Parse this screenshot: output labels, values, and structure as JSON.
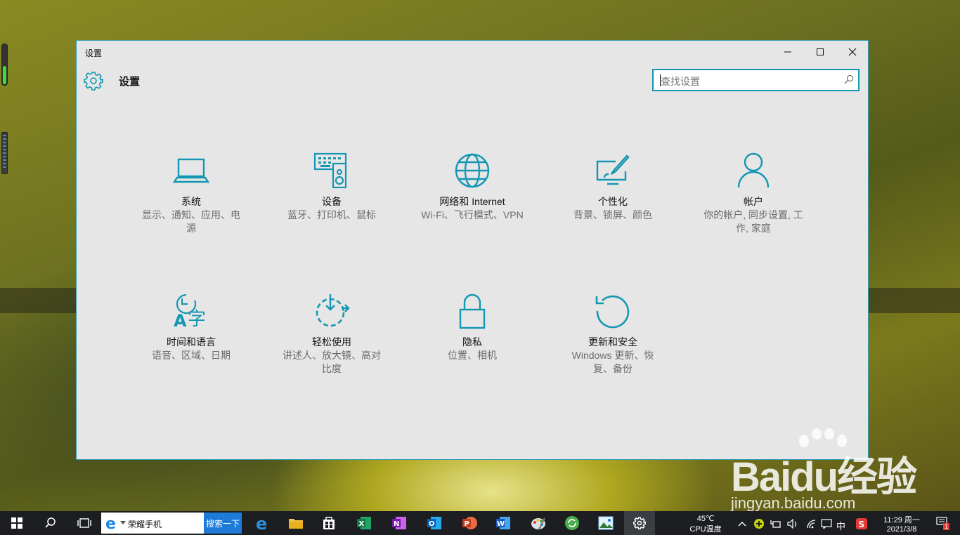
{
  "window": {
    "title": "设置",
    "header_label": "设置",
    "search_placeholder": "查找设置"
  },
  "tiles": [
    {
      "name": "系统",
      "desc1": "显示、通知、应用、电",
      "desc2": "源",
      "icon": "laptop-icon"
    },
    {
      "name": "设备",
      "desc1": "蓝牙、打印机、鼠标",
      "desc2": "",
      "icon": "devices-icon"
    },
    {
      "name": "网络和 Internet",
      "desc1": "Wi-Fi、飞行模式、VPN",
      "desc2": "",
      "icon": "globe-icon"
    },
    {
      "name": "个性化",
      "desc1": "背景、锁屏、颜色",
      "desc2": "",
      "icon": "personalization-icon"
    },
    {
      "name": "帐户",
      "desc1": "你的帐户, 同步设置, 工",
      "desc2": "作, 家庭",
      "icon": "person-icon"
    },
    {
      "name": "时间和语言",
      "desc1": "语音、区域、日期",
      "desc2": "",
      "icon": "time-language-icon"
    },
    {
      "name": "轻松使用",
      "desc1": "讲述人、放大镜、高对",
      "desc2": "比度",
      "icon": "ease-of-access-icon"
    },
    {
      "name": "隐私",
      "desc1": "位置、相机",
      "desc2": "",
      "icon": "lock-icon"
    },
    {
      "name": "更新和安全",
      "desc1": "Windows 更新、恢",
      "desc2": "复、备份",
      "icon": "update-icon"
    }
  ],
  "taskbar": {
    "ie_text": "荣耀手机",
    "search_button": "搜索一下",
    "temp": "45℃",
    "cpu_label": "CPU温度",
    "time": "11:29 周一",
    "date": "2021/3/8",
    "ime": "中",
    "notification_count": "1"
  },
  "watermark": {
    "brand": "Baidu经验",
    "url": "jingyan.baidu.com"
  },
  "colors": {
    "accent": "#1497b3",
    "window_bg": "#e6e6e6",
    "taskbar_bg": "#1c1e21"
  }
}
